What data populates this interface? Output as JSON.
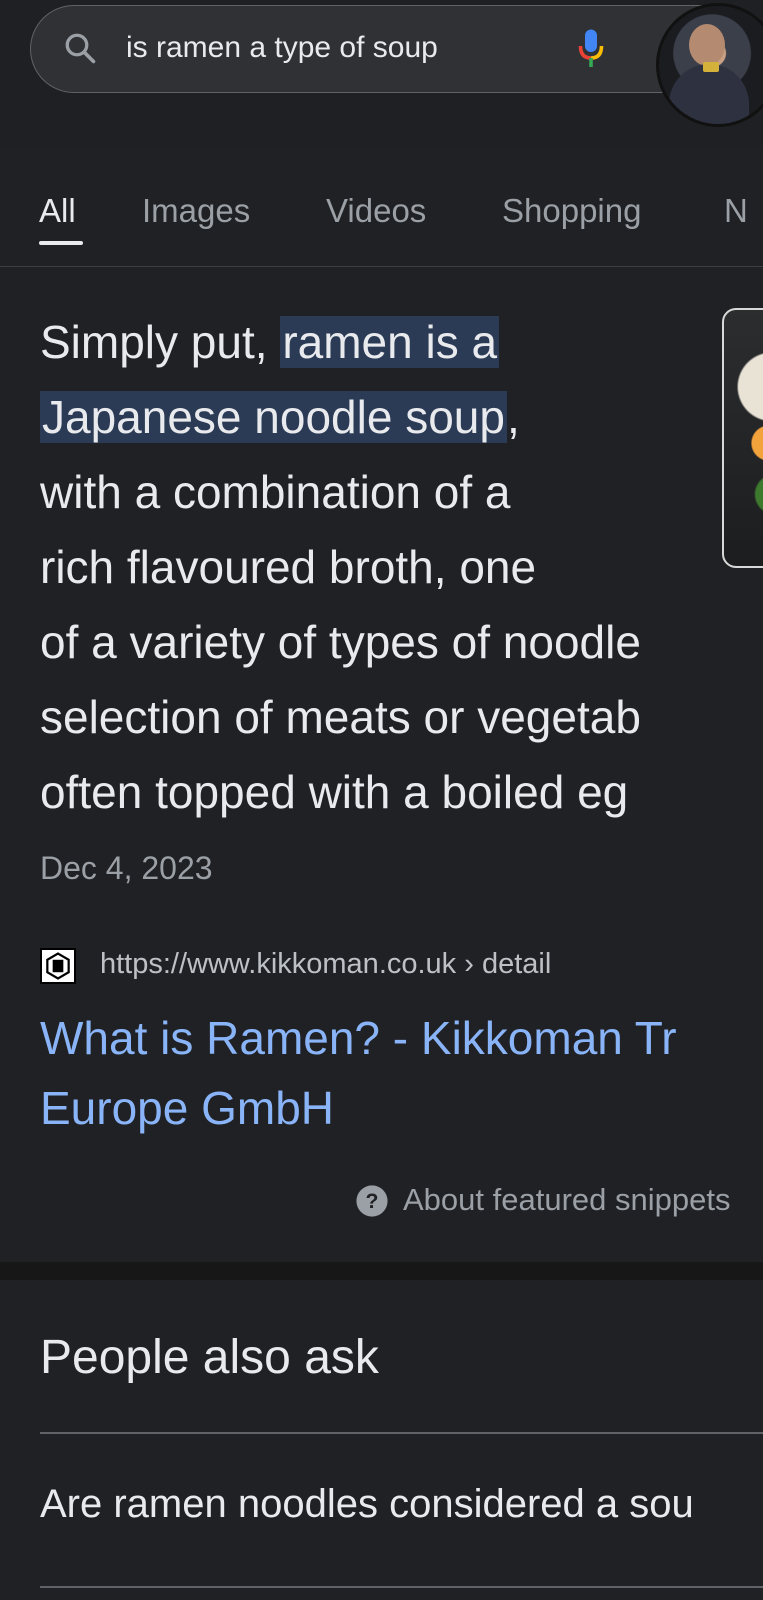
{
  "search": {
    "query": "is ramen a type of soup"
  },
  "tabs": [
    {
      "label": "All",
      "active": true
    },
    {
      "label": "Images",
      "active": false
    },
    {
      "label": "Videos",
      "active": false
    },
    {
      "label": "Shopping",
      "active": false
    },
    {
      "label": "N",
      "active": false
    }
  ],
  "snippet": {
    "line1_pre": "Simply put, ",
    "line1_hl": "ramen is a",
    "line2_hl": "Japanese noodle soup",
    "line2_post": ",",
    "line3": "with a combination of a",
    "line4": "rich flavoured broth, one",
    "line5": "of a variety of types of noodle",
    "line6": "selection of meats or vegetab",
    "line7": "often topped with a boiled eg",
    "date": "Dec 4, 2023"
  },
  "source": {
    "url": "https://www.kikkoman.co.uk › detail",
    "title_line1": "What is Ramen? - Kikkoman Tr",
    "title_line2": "Europe GmbH"
  },
  "about_snippets": "About featured snippets",
  "people_also_ask": {
    "title": "People also ask",
    "questions": [
      "Are ramen noodles considered a sou"
    ]
  },
  "colors": {
    "background": "#202124",
    "link": "#8ab4f8",
    "highlight": "#2b3a55",
    "muted": "#9aa0a6"
  }
}
